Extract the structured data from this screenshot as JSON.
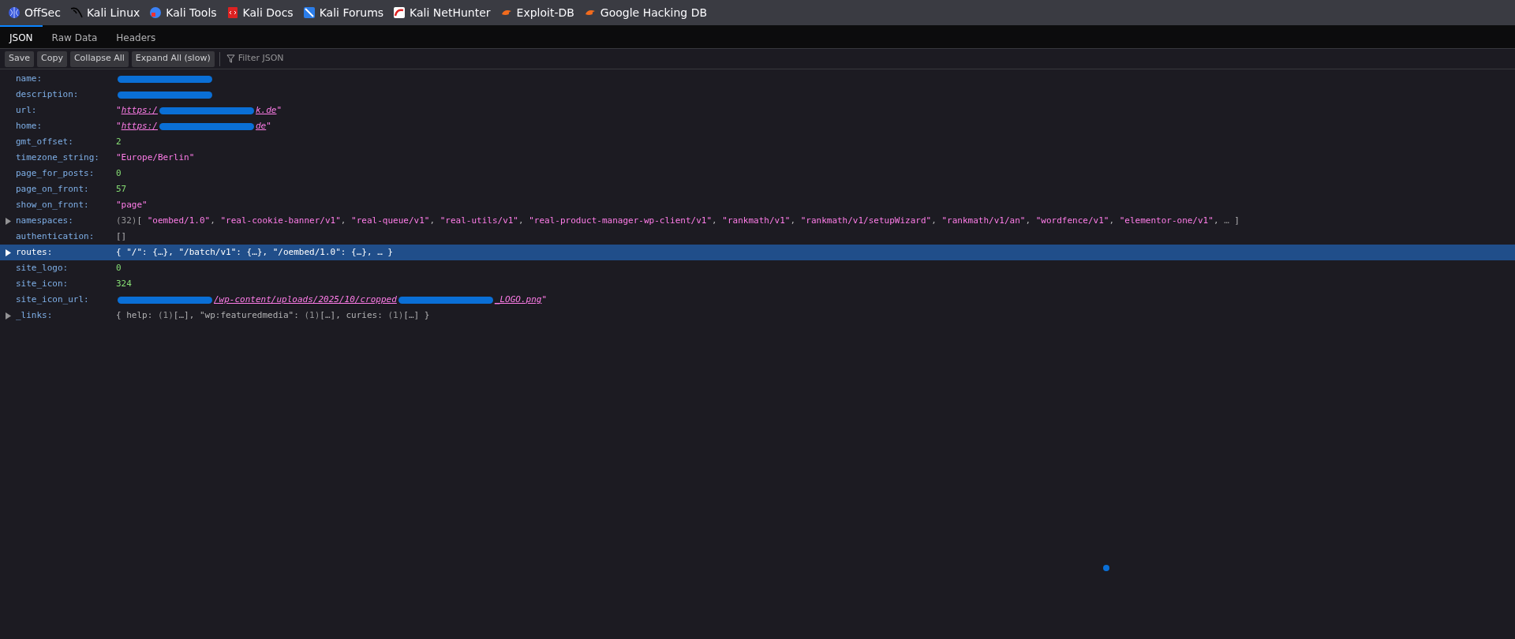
{
  "bookmarks": [
    {
      "label": "OffSec",
      "kind": "globe"
    },
    {
      "label": "Kali Linux",
      "kind": "dragon"
    },
    {
      "label": "Kali Tools",
      "kind": "tools"
    },
    {
      "label": "Kali Docs",
      "kind": "docs"
    },
    {
      "label": "Kali Forums",
      "kind": "forums"
    },
    {
      "label": "Kali NetHunter",
      "kind": "nethunter"
    },
    {
      "label": "Exploit-DB",
      "kind": "bug"
    },
    {
      "label": "Google Hacking DB",
      "kind": "bug"
    }
  ],
  "tabs": [
    {
      "label": "JSON",
      "selected": true
    },
    {
      "label": "Raw Data",
      "selected": false
    },
    {
      "label": "Headers",
      "selected": false
    }
  ],
  "toolbar": {
    "buttons": [
      "Save",
      "Copy",
      "Collapse All",
      "Expand All (slow)"
    ],
    "filter": {
      "placeholder": "Filter JSON"
    }
  },
  "rows": [
    {
      "key": "name:",
      "expandable": false,
      "selected": false,
      "value": [
        {
          "kind": "redacted"
        }
      ]
    },
    {
      "key": "description:",
      "expandable": false,
      "selected": false,
      "value": [
        {
          "kind": "redacted"
        }
      ]
    },
    {
      "key": "url:",
      "expandable": false,
      "selected": false,
      "value": [
        {
          "kind": "string",
          "text": "\""
        },
        {
          "kind": "link",
          "text": "https:/"
        },
        {
          "kind": "redacted"
        },
        {
          "kind": "link",
          "text": "k.de"
        },
        {
          "kind": "string",
          "text": "\""
        }
      ]
    },
    {
      "key": "home:",
      "expandable": false,
      "selected": false,
      "value": [
        {
          "kind": "string",
          "text": "\""
        },
        {
          "kind": "link",
          "text": "https:/"
        },
        {
          "kind": "redacted"
        },
        {
          "kind": "link",
          "text": "de"
        },
        {
          "kind": "string",
          "text": "\""
        }
      ]
    },
    {
      "key": "gmt_offset:",
      "expandable": false,
      "selected": false,
      "value": [
        {
          "kind": "number",
          "text": "2"
        }
      ]
    },
    {
      "key": "timezone_string:",
      "expandable": false,
      "selected": false,
      "value": [
        {
          "kind": "string",
          "text": "\"Europe/Berlin\""
        }
      ]
    },
    {
      "key": "page_for_posts:",
      "expandable": false,
      "selected": false,
      "value": [
        {
          "kind": "number",
          "text": "0"
        }
      ]
    },
    {
      "key": "page_on_front:",
      "expandable": false,
      "selected": false,
      "value": [
        {
          "kind": "number",
          "text": "57"
        }
      ]
    },
    {
      "key": "show_on_front:",
      "expandable": false,
      "selected": false,
      "value": [
        {
          "kind": "string",
          "text": "\"page\""
        }
      ]
    },
    {
      "key": "namespaces:",
      "expandable": true,
      "selected": false,
      "value": [
        {
          "kind": "muted",
          "text": "(32)"
        },
        {
          "kind": "punct",
          "text": "[ "
        },
        {
          "kind": "string",
          "text": "\"oembed/1.0\""
        },
        {
          "kind": "punct",
          "text": ", "
        },
        {
          "kind": "string",
          "text": "\"real-cookie-banner/v1\""
        },
        {
          "kind": "punct",
          "text": ", "
        },
        {
          "kind": "string",
          "text": "\"real-queue/v1\""
        },
        {
          "kind": "punct",
          "text": ", "
        },
        {
          "kind": "string",
          "text": "\"real-utils/v1\""
        },
        {
          "kind": "punct",
          "text": ", "
        },
        {
          "kind": "string",
          "text": "\"real-product-manager-wp-client/v1\""
        },
        {
          "kind": "punct",
          "text": ", "
        },
        {
          "kind": "string",
          "text": "\"rankmath/v1\""
        },
        {
          "kind": "punct",
          "text": ", "
        },
        {
          "kind": "string",
          "text": "\"rankmath/v1/setupWizard\""
        },
        {
          "kind": "punct",
          "text": ", "
        },
        {
          "kind": "string",
          "text": "\"rankmath/v1/an\""
        },
        {
          "kind": "punct",
          "text": ", "
        },
        {
          "kind": "string",
          "text": "\"wordfence/v1\""
        },
        {
          "kind": "punct",
          "text": ", "
        },
        {
          "kind": "string",
          "text": "\"elementor-one/v1\""
        },
        {
          "kind": "punct",
          "text": ", "
        },
        {
          "kind": "muted",
          "text": "…"
        },
        {
          "kind": "punct",
          "text": " ]"
        }
      ]
    },
    {
      "key": "authentication:",
      "expandable": false,
      "selected": false,
      "value": [
        {
          "kind": "punct",
          "text": "[]"
        }
      ]
    },
    {
      "key": "routes:",
      "expandable": true,
      "selected": true,
      "value": [
        {
          "kind": "punct",
          "text": "{ \"/\": {…}, \"/batch/v1\": {…}, \"/oembed/1.0\": {…}, … }"
        }
      ]
    },
    {
      "key": "site_logo:",
      "expandable": false,
      "selected": false,
      "value": [
        {
          "kind": "number",
          "text": "0"
        }
      ]
    },
    {
      "key": "site_icon:",
      "expandable": false,
      "selected": false,
      "value": [
        {
          "kind": "number",
          "text": "324"
        }
      ]
    },
    {
      "key": "site_icon_url:",
      "expandable": false,
      "selected": false,
      "value": [
        {
          "kind": "redacted"
        },
        {
          "kind": "link",
          "text": "/wp-content/uploads/2025/10/cropped"
        },
        {
          "kind": "redacted"
        },
        {
          "kind": "link",
          "text": "_LOGO.png"
        },
        {
          "kind": "string",
          "text": "\""
        }
      ]
    },
    {
      "key": "_links:",
      "expandable": true,
      "selected": false,
      "value": [
        {
          "kind": "punct",
          "text": "{ help: "
        },
        {
          "kind": "muted",
          "text": "(1)"
        },
        {
          "kind": "punct",
          "text": "[…], \"wp:featuredmedia\": "
        },
        {
          "kind": "muted",
          "text": "(1)"
        },
        {
          "kind": "punct",
          "text": "[…], curies: "
        },
        {
          "kind": "muted",
          "text": "(1)"
        },
        {
          "kind": "punct",
          "text": "[…] }"
        }
      ]
    }
  ]
}
